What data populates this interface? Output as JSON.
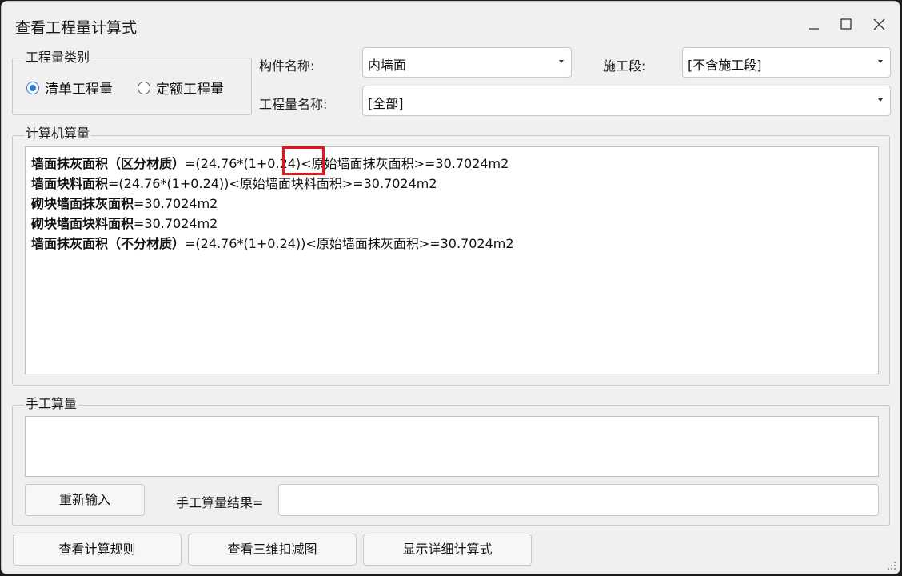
{
  "window": {
    "title": "查看工程量计算式",
    "icons": {
      "minimize": "minimize-icon",
      "maximize": "maximize-icon",
      "close": "close-icon"
    }
  },
  "category": {
    "legend": "工程量类别",
    "options": [
      {
        "label": "清单工程量",
        "selected": true
      },
      {
        "label": "定额工程量",
        "selected": false
      }
    ]
  },
  "fields": {
    "component_label": "构件名称:",
    "component_value": "内墙面",
    "stage_label": "施工段:",
    "stage_value": "[不含施工段]",
    "quantity_name_label": "工程量名称:",
    "quantity_name_value": "[全部]"
  },
  "computer": {
    "legend": "计算机算量",
    "lines": [
      {
        "name": "墙面抹灰面积（区分材质）",
        "pre": "=(24.76*(1+",
        "hl": "0.24)",
        "post": "<原始墙面抹灰面积>=30.7024m2"
      },
      {
        "name": "墙面块料面积",
        "pre": "=(24.76*(1+0.24))<原始墙面块料面积>=30.7024m2",
        "hl": "",
        "post": ""
      },
      {
        "name": "砌块墙面抹灰面积",
        "pre": "=30.7024m2",
        "hl": "",
        "post": ""
      },
      {
        "name": "砌块墙面块料面积",
        "pre": "=30.7024m2",
        "hl": "",
        "post": ""
      },
      {
        "name": "墙面抹灰面积（不分材质）",
        "pre": "=(24.76*(1+0.24))<原始墙面抹灰面积>=30.7024m2",
        "hl": "",
        "post": ""
      }
    ],
    "highlight_color": "#e3141c"
  },
  "manual": {
    "legend": "手工算量",
    "reenter_label": "重新输入",
    "result_label": "手工算量结果=",
    "result_value": ""
  },
  "buttons": {
    "view_rules": "查看计算规则",
    "view_3d": "查看三维扣减图",
    "show_detail": "显示详细计算式"
  },
  "colors": {
    "accent": "#2b79d1",
    "window_bg": "#f0f0f0"
  }
}
